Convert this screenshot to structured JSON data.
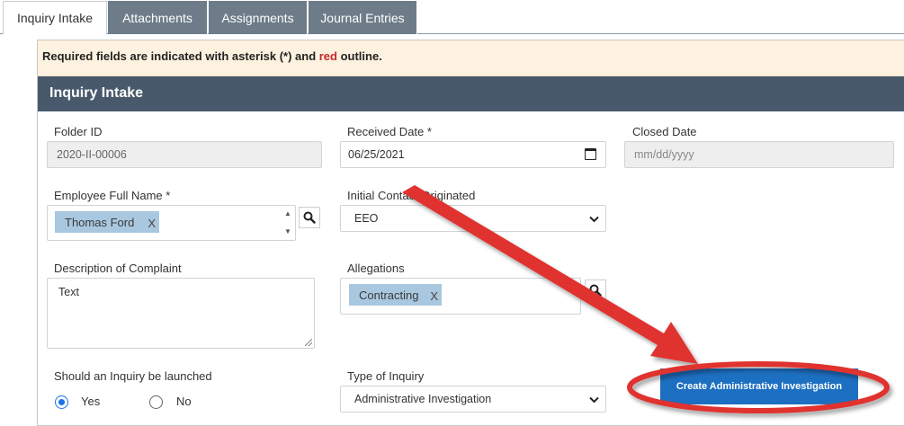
{
  "tabs": [
    {
      "label": "Inquiry Intake"
    },
    {
      "label": "Attachments"
    },
    {
      "label": "Assignments"
    },
    {
      "label": "Journal Entries"
    }
  ],
  "notice": {
    "part1": "Required fields are indicated with asterisk (*) and ",
    "part2": "red",
    "part3": " outline."
  },
  "section_title": "Inquiry Intake",
  "form": {
    "folder_id": {
      "label": "Folder ID",
      "value": "2020-II-00006"
    },
    "received_date": {
      "label": "Received Date *",
      "value": "06/25/2021"
    },
    "closed_date": {
      "label": "Closed Date",
      "placeholder": "mm/dd/yyyy"
    },
    "employee_full_name": {
      "label": "Employee Full Name *",
      "tag": "Thomas Ford",
      "remove": "X"
    },
    "initial_contact": {
      "label": "Initial Contact Originated",
      "value": "EEO"
    },
    "description": {
      "label": "Description of Complaint",
      "value": "Text"
    },
    "allegations": {
      "label": "Allegations",
      "tag": "Contracting",
      "remove": "X"
    },
    "launch_inquiry": {
      "label": "Should an Inquiry be launched",
      "yes": "Yes",
      "no": "No",
      "selected": "Yes"
    },
    "type_of_inquiry": {
      "label": "Type of Inquiry",
      "value": "Administrative Investigation"
    }
  },
  "actions": {
    "create_label": "Create Administrative Investigation"
  },
  "icons": {
    "search": "search-icon",
    "calendar": "calendar-icon",
    "dropdown": "chevron-down-icon"
  },
  "colors": {
    "header": "#49596c",
    "tab": "#6e7c89",
    "button": "#1d6fc1",
    "annotation": "#e0302e",
    "notice_bg": "#fdf2df"
  }
}
